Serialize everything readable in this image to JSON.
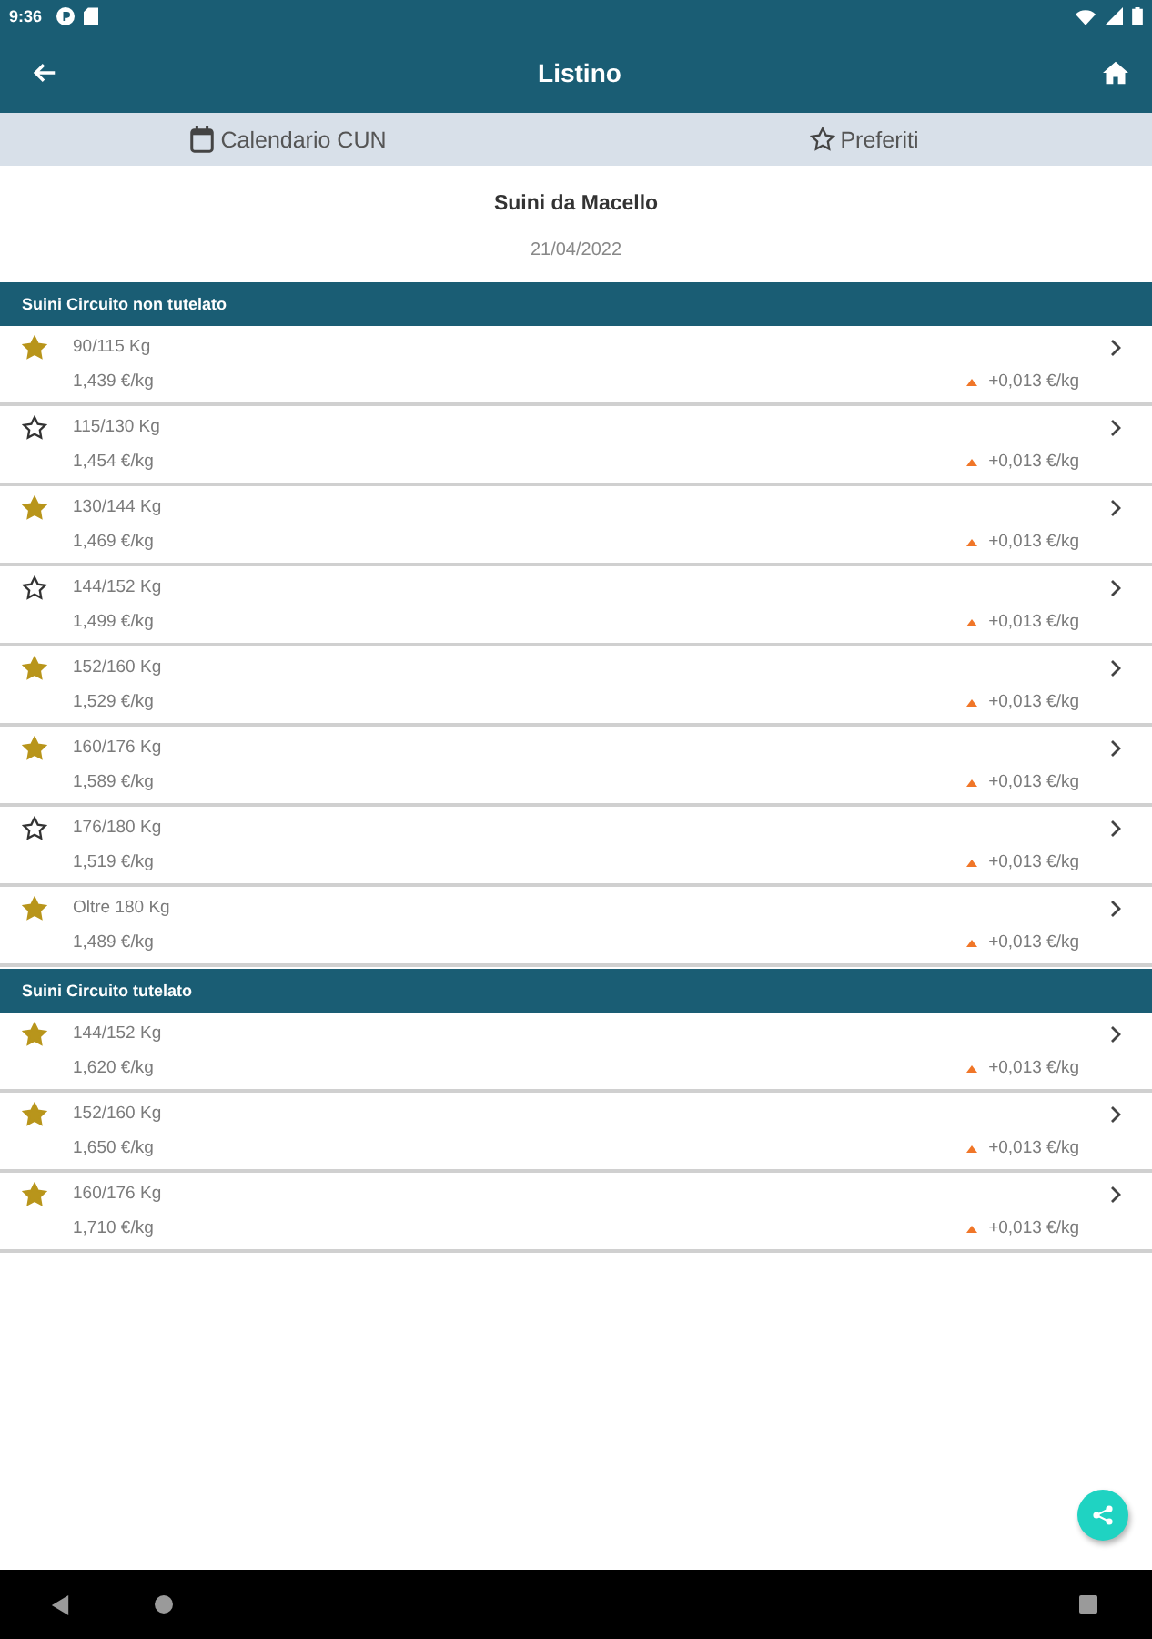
{
  "status_bar": {
    "time": "9:36"
  },
  "app_bar": {
    "title": "Listino"
  },
  "toolbar": [
    {
      "kind": "calendar",
      "label": "Calendario CUN"
    },
    {
      "kind": "favorites",
      "label": "Preferiti"
    }
  ],
  "header": {
    "title": "Suini da Macello",
    "date": "21/04/2022"
  },
  "sections": [
    {
      "title": "Suini Circuito non tutelato",
      "rows": [
        {
          "favorite": true,
          "weight": "90/115 Kg",
          "price": "1,439 €/kg",
          "rising": true,
          "change": "+0,013 €/kg"
        },
        {
          "favorite": false,
          "weight": "115/130 Kg",
          "price": "1,454 €/kg",
          "rising": true,
          "change": "+0,013 €/kg"
        },
        {
          "favorite": true,
          "weight": "130/144 Kg",
          "price": "1,469 €/kg",
          "rising": true,
          "change": "+0,013 €/kg"
        },
        {
          "favorite": false,
          "weight": "144/152 Kg",
          "price": "1,499 €/kg",
          "rising": true,
          "change": "+0,013 €/kg"
        },
        {
          "favorite": true,
          "weight": "152/160 Kg",
          "price": "1,529 €/kg",
          "rising": true,
          "change": "+0,013 €/kg"
        },
        {
          "favorite": true,
          "weight": "160/176 Kg",
          "price": "1,589 €/kg",
          "rising": true,
          "change": "+0,013 €/kg"
        },
        {
          "favorite": false,
          "weight": "176/180 Kg",
          "price": "1,519 €/kg",
          "rising": true,
          "change": "+0,013 €/kg"
        },
        {
          "favorite": true,
          "weight": "Oltre 180 Kg",
          "price": "1,489 €/kg",
          "rising": true,
          "change": "+0,013 €/kg"
        }
      ]
    },
    {
      "title": "Suini Circuito tutelato",
      "rows": [
        {
          "favorite": true,
          "weight": "144/152 Kg",
          "price": "1,620 €/kg",
          "rising": true,
          "change": "+0,013 €/kg"
        },
        {
          "favorite": true,
          "weight": "152/160 Kg",
          "price": "1,650 €/kg",
          "rising": true,
          "change": "+0,013 €/kg"
        },
        {
          "favorite": true,
          "weight": "160/176 Kg",
          "price": "1,710 €/kg",
          "rising": true,
          "change": "+0,013 €/kg"
        }
      ]
    }
  ]
}
